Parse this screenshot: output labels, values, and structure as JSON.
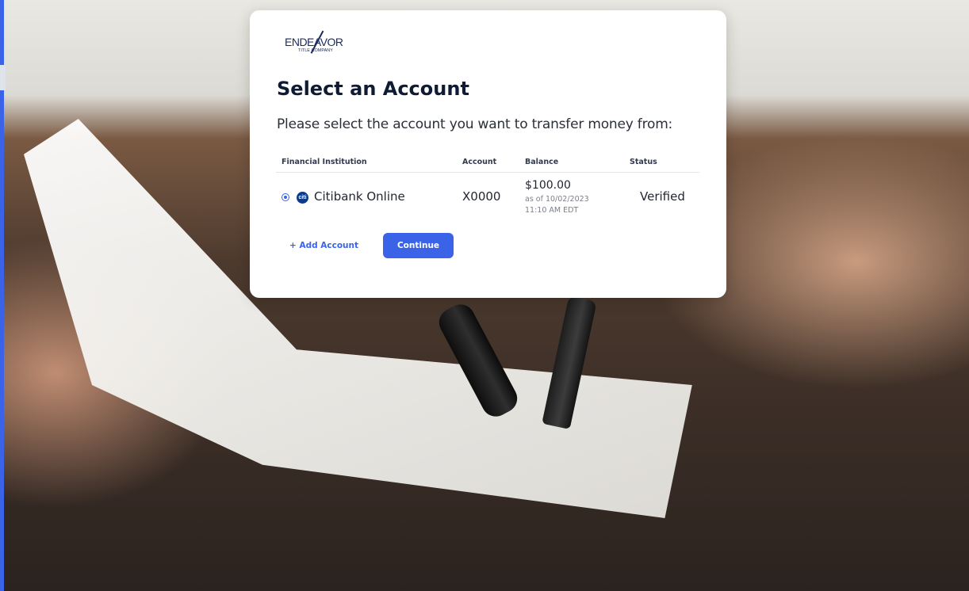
{
  "logo": {
    "wordmark": "ENDEAVOR",
    "tagline": "TITLE COMPANY"
  },
  "page": {
    "title": "Select an Account",
    "subtitle": "Please select the account you want to transfer money from:"
  },
  "table": {
    "headers": {
      "institution": "Financial Institution",
      "account": "Account",
      "balance": "Balance",
      "status": "Status"
    },
    "rows": [
      {
        "selected": true,
        "bank_icon": "citi",
        "institution": "Citibank Online",
        "account": "X0000",
        "balance": "$100.00",
        "balance_asof": "as of 10/02/2023",
        "balance_time": "11:10 AM EDT",
        "status": "Verified"
      }
    ]
  },
  "actions": {
    "add_account_label": "+ Add Account",
    "continue_label": "Continue"
  },
  "colors": {
    "accent": "#3b63e8",
    "title": "#0f1a33",
    "muted": "#7b808c",
    "card": "#ffffff"
  },
  "icons": {
    "bank": "citi-bank-icon",
    "radio": "radio-selected-icon"
  }
}
